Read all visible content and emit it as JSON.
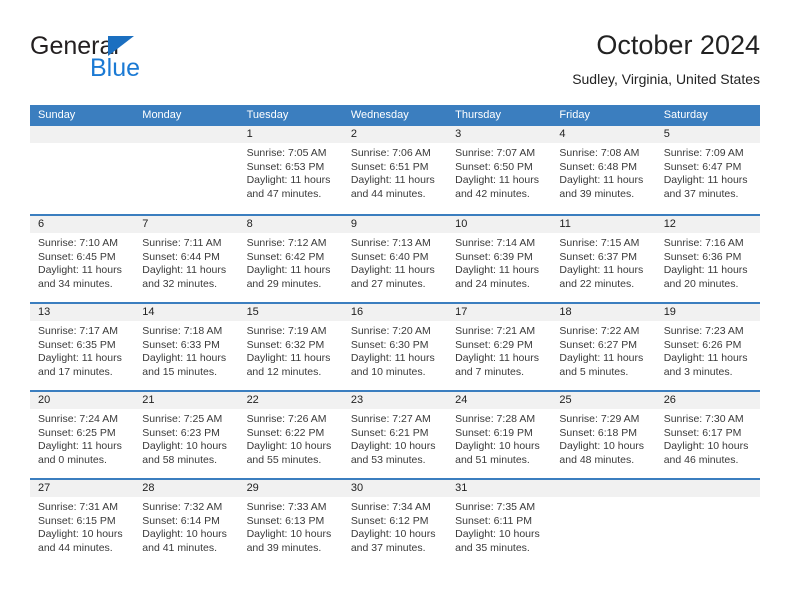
{
  "brand": {
    "word1": "General",
    "word2": "Blue",
    "triangle_color": "#1b6fc0",
    "blue_color": "#1b7ad4"
  },
  "header": {
    "title": "October 2024",
    "subtitle": "Sudley, Virginia, United States"
  },
  "theme": {
    "header_bg": "#3b7ebf",
    "daynum_bg": "#f1f1f1",
    "row_rule": "#3b7ebf",
    "text": "#222222"
  },
  "calendar": {
    "weekdays": [
      "Sunday",
      "Monday",
      "Tuesday",
      "Wednesday",
      "Thursday",
      "Friday",
      "Saturday"
    ],
    "weeks": [
      [
        {
          "day": "",
          "sunrise": "",
          "sunset": "",
          "daylight1": "",
          "daylight2": ""
        },
        {
          "day": "",
          "sunrise": "",
          "sunset": "",
          "daylight1": "",
          "daylight2": ""
        },
        {
          "day": "1",
          "sunrise": "Sunrise: 7:05 AM",
          "sunset": "Sunset: 6:53 PM",
          "daylight1": "Daylight: 11 hours",
          "daylight2": "and 47 minutes."
        },
        {
          "day": "2",
          "sunrise": "Sunrise: 7:06 AM",
          "sunset": "Sunset: 6:51 PM",
          "daylight1": "Daylight: 11 hours",
          "daylight2": "and 44 minutes."
        },
        {
          "day": "3",
          "sunrise": "Sunrise: 7:07 AM",
          "sunset": "Sunset: 6:50 PM",
          "daylight1": "Daylight: 11 hours",
          "daylight2": "and 42 minutes."
        },
        {
          "day": "4",
          "sunrise": "Sunrise: 7:08 AM",
          "sunset": "Sunset: 6:48 PM",
          "daylight1": "Daylight: 11 hours",
          "daylight2": "and 39 minutes."
        },
        {
          "day": "5",
          "sunrise": "Sunrise: 7:09 AM",
          "sunset": "Sunset: 6:47 PM",
          "daylight1": "Daylight: 11 hours",
          "daylight2": "and 37 minutes."
        }
      ],
      [
        {
          "day": "6",
          "sunrise": "Sunrise: 7:10 AM",
          "sunset": "Sunset: 6:45 PM",
          "daylight1": "Daylight: 11 hours",
          "daylight2": "and 34 minutes."
        },
        {
          "day": "7",
          "sunrise": "Sunrise: 7:11 AM",
          "sunset": "Sunset: 6:44 PM",
          "daylight1": "Daylight: 11 hours",
          "daylight2": "and 32 minutes."
        },
        {
          "day": "8",
          "sunrise": "Sunrise: 7:12 AM",
          "sunset": "Sunset: 6:42 PM",
          "daylight1": "Daylight: 11 hours",
          "daylight2": "and 29 minutes."
        },
        {
          "day": "9",
          "sunrise": "Sunrise: 7:13 AM",
          "sunset": "Sunset: 6:40 PM",
          "daylight1": "Daylight: 11 hours",
          "daylight2": "and 27 minutes."
        },
        {
          "day": "10",
          "sunrise": "Sunrise: 7:14 AM",
          "sunset": "Sunset: 6:39 PM",
          "daylight1": "Daylight: 11 hours",
          "daylight2": "and 24 minutes."
        },
        {
          "day": "11",
          "sunrise": "Sunrise: 7:15 AM",
          "sunset": "Sunset: 6:37 PM",
          "daylight1": "Daylight: 11 hours",
          "daylight2": "and 22 minutes."
        },
        {
          "day": "12",
          "sunrise": "Sunrise: 7:16 AM",
          "sunset": "Sunset: 6:36 PM",
          "daylight1": "Daylight: 11 hours",
          "daylight2": "and 20 minutes."
        }
      ],
      [
        {
          "day": "13",
          "sunrise": "Sunrise: 7:17 AM",
          "sunset": "Sunset: 6:35 PM",
          "daylight1": "Daylight: 11 hours",
          "daylight2": "and 17 minutes."
        },
        {
          "day": "14",
          "sunrise": "Sunrise: 7:18 AM",
          "sunset": "Sunset: 6:33 PM",
          "daylight1": "Daylight: 11 hours",
          "daylight2": "and 15 minutes."
        },
        {
          "day": "15",
          "sunrise": "Sunrise: 7:19 AM",
          "sunset": "Sunset: 6:32 PM",
          "daylight1": "Daylight: 11 hours",
          "daylight2": "and 12 minutes."
        },
        {
          "day": "16",
          "sunrise": "Sunrise: 7:20 AM",
          "sunset": "Sunset: 6:30 PM",
          "daylight1": "Daylight: 11 hours",
          "daylight2": "and 10 minutes."
        },
        {
          "day": "17",
          "sunrise": "Sunrise: 7:21 AM",
          "sunset": "Sunset: 6:29 PM",
          "daylight1": "Daylight: 11 hours",
          "daylight2": "and 7 minutes."
        },
        {
          "day": "18",
          "sunrise": "Sunrise: 7:22 AM",
          "sunset": "Sunset: 6:27 PM",
          "daylight1": "Daylight: 11 hours",
          "daylight2": "and 5 minutes."
        },
        {
          "day": "19",
          "sunrise": "Sunrise: 7:23 AM",
          "sunset": "Sunset: 6:26 PM",
          "daylight1": "Daylight: 11 hours",
          "daylight2": "and 3 minutes."
        }
      ],
      [
        {
          "day": "20",
          "sunrise": "Sunrise: 7:24 AM",
          "sunset": "Sunset: 6:25 PM",
          "daylight1": "Daylight: 11 hours",
          "daylight2": "and 0 minutes."
        },
        {
          "day": "21",
          "sunrise": "Sunrise: 7:25 AM",
          "sunset": "Sunset: 6:23 PM",
          "daylight1": "Daylight: 10 hours",
          "daylight2": "and 58 minutes."
        },
        {
          "day": "22",
          "sunrise": "Sunrise: 7:26 AM",
          "sunset": "Sunset: 6:22 PM",
          "daylight1": "Daylight: 10 hours",
          "daylight2": "and 55 minutes."
        },
        {
          "day": "23",
          "sunrise": "Sunrise: 7:27 AM",
          "sunset": "Sunset: 6:21 PM",
          "daylight1": "Daylight: 10 hours",
          "daylight2": "and 53 minutes."
        },
        {
          "day": "24",
          "sunrise": "Sunrise: 7:28 AM",
          "sunset": "Sunset: 6:19 PM",
          "daylight1": "Daylight: 10 hours",
          "daylight2": "and 51 minutes."
        },
        {
          "day": "25",
          "sunrise": "Sunrise: 7:29 AM",
          "sunset": "Sunset: 6:18 PM",
          "daylight1": "Daylight: 10 hours",
          "daylight2": "and 48 minutes."
        },
        {
          "day": "26",
          "sunrise": "Sunrise: 7:30 AM",
          "sunset": "Sunset: 6:17 PM",
          "daylight1": "Daylight: 10 hours",
          "daylight2": "and 46 minutes."
        }
      ],
      [
        {
          "day": "27",
          "sunrise": "Sunrise: 7:31 AM",
          "sunset": "Sunset: 6:15 PM",
          "daylight1": "Daylight: 10 hours",
          "daylight2": "and 44 minutes."
        },
        {
          "day": "28",
          "sunrise": "Sunrise: 7:32 AM",
          "sunset": "Sunset: 6:14 PM",
          "daylight1": "Daylight: 10 hours",
          "daylight2": "and 41 minutes."
        },
        {
          "day": "29",
          "sunrise": "Sunrise: 7:33 AM",
          "sunset": "Sunset: 6:13 PM",
          "daylight1": "Daylight: 10 hours",
          "daylight2": "and 39 minutes."
        },
        {
          "day": "30",
          "sunrise": "Sunrise: 7:34 AM",
          "sunset": "Sunset: 6:12 PM",
          "daylight1": "Daylight: 10 hours",
          "daylight2": "and 37 minutes."
        },
        {
          "day": "31",
          "sunrise": "Sunrise: 7:35 AM",
          "sunset": "Sunset: 6:11 PM",
          "daylight1": "Daylight: 10 hours",
          "daylight2": "and 35 minutes."
        },
        {
          "day": "",
          "sunrise": "",
          "sunset": "",
          "daylight1": "",
          "daylight2": ""
        },
        {
          "day": "",
          "sunrise": "",
          "sunset": "",
          "daylight1": "",
          "daylight2": ""
        }
      ]
    ]
  }
}
